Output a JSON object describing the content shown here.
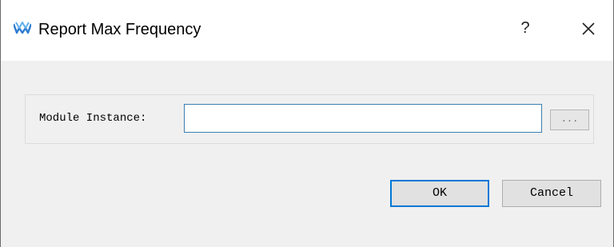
{
  "window": {
    "title": "Report Max Frequency",
    "app_icon": "gowin-logo-icon",
    "help_label": "?",
    "close_icon": "close-icon",
    "accent_color": "#0078d7"
  },
  "form": {
    "module_instance_label": "Module Instance:",
    "module_instance_value": "",
    "browse_label": "..."
  },
  "buttons": {
    "ok_label": "OK",
    "cancel_label": "Cancel"
  }
}
